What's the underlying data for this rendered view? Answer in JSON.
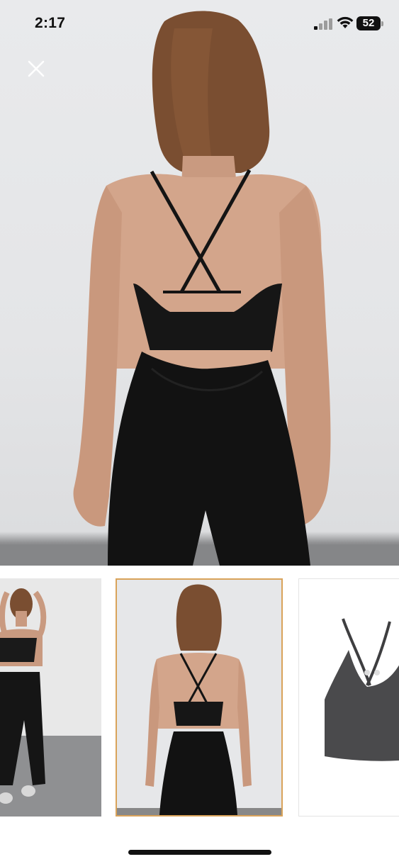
{
  "status_bar": {
    "time": "2:17",
    "battery_level": "52"
  },
  "viewer": {
    "close_icon": "close-icon",
    "main_image": "model-back-view-sports-bra-photo",
    "thumbnails": [
      {
        "image": "model-front-view-photo",
        "selected": false
      },
      {
        "image": "model-back-view-photo",
        "selected": true
      },
      {
        "image": "gray-sports-bra-product-photo",
        "selected": false
      }
    ],
    "selected_border_color": "#d9a35a"
  }
}
